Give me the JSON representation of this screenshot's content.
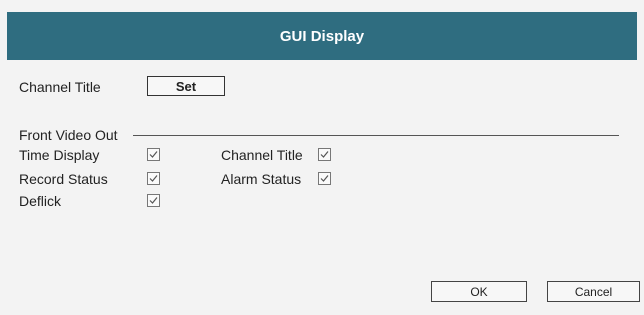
{
  "dialog": {
    "title": "GUI Display",
    "channel_title_label": "Channel Title",
    "set_button": "Set",
    "section_title": "Front Video Out",
    "options": [
      {
        "label": "Time Display",
        "checked": true
      },
      {
        "label": "Record Status",
        "checked": true
      },
      {
        "label": "Deflick",
        "checked": true
      },
      {
        "label": "Channel Title",
        "checked": true
      },
      {
        "label": "Alarm Status",
        "checked": true
      }
    ],
    "ok_button": "OK",
    "cancel_button": "Cancel"
  },
  "colors": {
    "titlebar": "#2f6d80",
    "background": "#f3f3f3"
  },
  "icons": {
    "checkbox_mark": "check-icon"
  }
}
